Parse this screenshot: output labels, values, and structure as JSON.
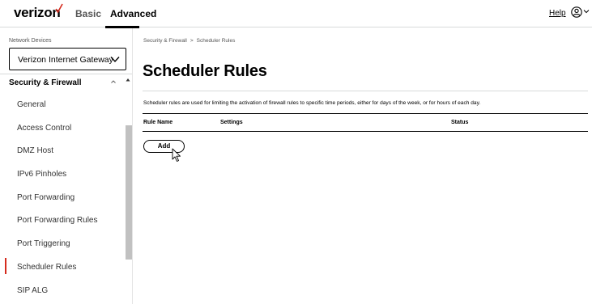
{
  "header": {
    "logo_text": "verizon",
    "tabs": [
      {
        "label": "Basic"
      },
      {
        "label": "Advanced"
      }
    ],
    "help_label": "Help",
    "accent_color": "#d52b1e"
  },
  "sidebar": {
    "network_devices_label": "Network Devices",
    "device_selected": "Verizon Internet Gateway",
    "section_title": "Security & Firewall",
    "items": [
      {
        "label": "General"
      },
      {
        "label": "Access Control"
      },
      {
        "label": "DMZ Host"
      },
      {
        "label": "IPv6 Pinholes"
      },
      {
        "label": "Port Forwarding"
      },
      {
        "label": "Port Forwarding Rules"
      },
      {
        "label": "Port Triggering"
      },
      {
        "label": "Scheduler Rules"
      },
      {
        "label": "SIP ALG"
      }
    ],
    "active_item": "Scheduler Rules"
  },
  "main": {
    "breadcrumb": [
      "Security & Firewall",
      "Scheduler Rules"
    ],
    "breadcrumb_separator": ">",
    "title": "Scheduler Rules",
    "description": "Scheduler rules are used for limiting the activation of firewall rules to specific time periods, either for days of the week, or for hours of each day.",
    "table": {
      "columns": [
        "Rule Name",
        "Settings",
        "Status"
      ],
      "rows": []
    },
    "add_button_label": "Add"
  },
  "icons": {
    "logo_check": "checkmark-icon",
    "user": "user-circle-icon",
    "user_menu": "chevron-down-icon",
    "device_dropdown": "chevron-down-icon",
    "section_toggle": "chevron-up-icon",
    "scroll_up": "scroll-up-arrow-icon",
    "cursor": "mouse-pointer-icon"
  }
}
